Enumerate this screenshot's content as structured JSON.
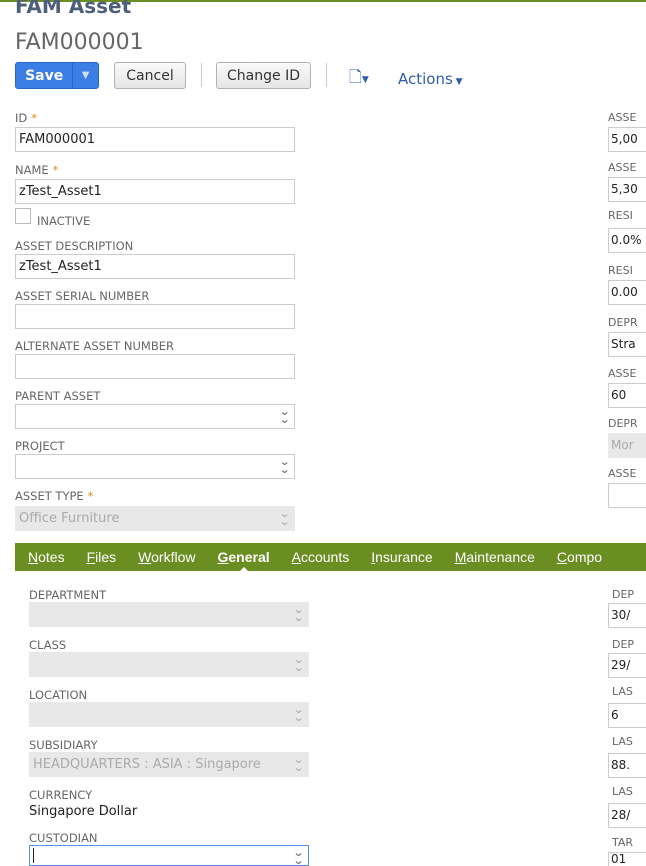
{
  "header": {
    "record_type": "FAM Asset",
    "record_id": "FAM000001"
  },
  "toolbar": {
    "save": "Save",
    "cancel": "Cancel",
    "change_id": "Change ID",
    "actions": "Actions"
  },
  "left_fields": [
    {
      "label": "ID",
      "required": "*",
      "value": "FAM000001"
    },
    {
      "label": "NAME",
      "required": "*",
      "value": "zTest_Asset1"
    },
    {
      "label": "ASSET DESCRIPTION",
      "value": "zTest_Asset1"
    },
    {
      "label": "ASSET SERIAL NUMBER",
      "value": ""
    },
    {
      "label": "ALTERNATE ASSET NUMBER",
      "value": ""
    },
    {
      "label": "PARENT ASSET",
      "value": ""
    },
    {
      "label": "PROJECT",
      "value": ""
    },
    {
      "label": "ASSET TYPE",
      "required": "*",
      "value": "Office Furniture"
    }
  ],
  "inactive_label": "INACTIVE",
  "right_fields": [
    {
      "label": "ASSE",
      "value": "5,00"
    },
    {
      "label": "ASSE",
      "value": "5,30"
    },
    {
      "label": "RESI",
      "value": "0.0%"
    },
    {
      "label": "RESI",
      "value": "0.00"
    },
    {
      "label": "DEPR",
      "value": "Stra"
    },
    {
      "label": "ASSE",
      "value": "60"
    },
    {
      "label": "DEPR",
      "value": "Mor"
    },
    {
      "label": "ASSE",
      "value": ""
    }
  ],
  "tabs": [
    {
      "first": "N",
      "rest": "otes"
    },
    {
      "first": "F",
      "rest": "iles"
    },
    {
      "first": "W",
      "rest": "orkflow"
    },
    {
      "first": "G",
      "rest": "eneral"
    },
    {
      "first": "A",
      "rest": "ccounts"
    },
    {
      "first": "I",
      "rest": "nsurance"
    },
    {
      "first": "M",
      "rest": "aintenance"
    },
    {
      "first": "C",
      "rest": "ompo"
    }
  ],
  "general": {
    "department": {
      "label": "DEPARTMENT",
      "value": ""
    },
    "class": {
      "label": "CLASS",
      "value": ""
    },
    "location": {
      "label": "LOCATION",
      "value": ""
    },
    "subsidiary": {
      "label": "SUBSIDIARY",
      "value": "HEADQUARTERS : ASIA : Singapore"
    },
    "currency": {
      "label": "CURRENCY",
      "value": "Singapore Dollar"
    },
    "custodian": {
      "label": "CUSTODIAN",
      "value": ""
    }
  },
  "general_right": [
    {
      "label": "DEP",
      "value": "30/"
    },
    {
      "label": "DEP",
      "value": "29/"
    },
    {
      "label": "LAS",
      "value": "6"
    },
    {
      "label": "LAS",
      "value": "88."
    },
    {
      "label": "LAS",
      "value": "28/"
    },
    {
      "label": "TAR",
      "value": "01"
    }
  ]
}
